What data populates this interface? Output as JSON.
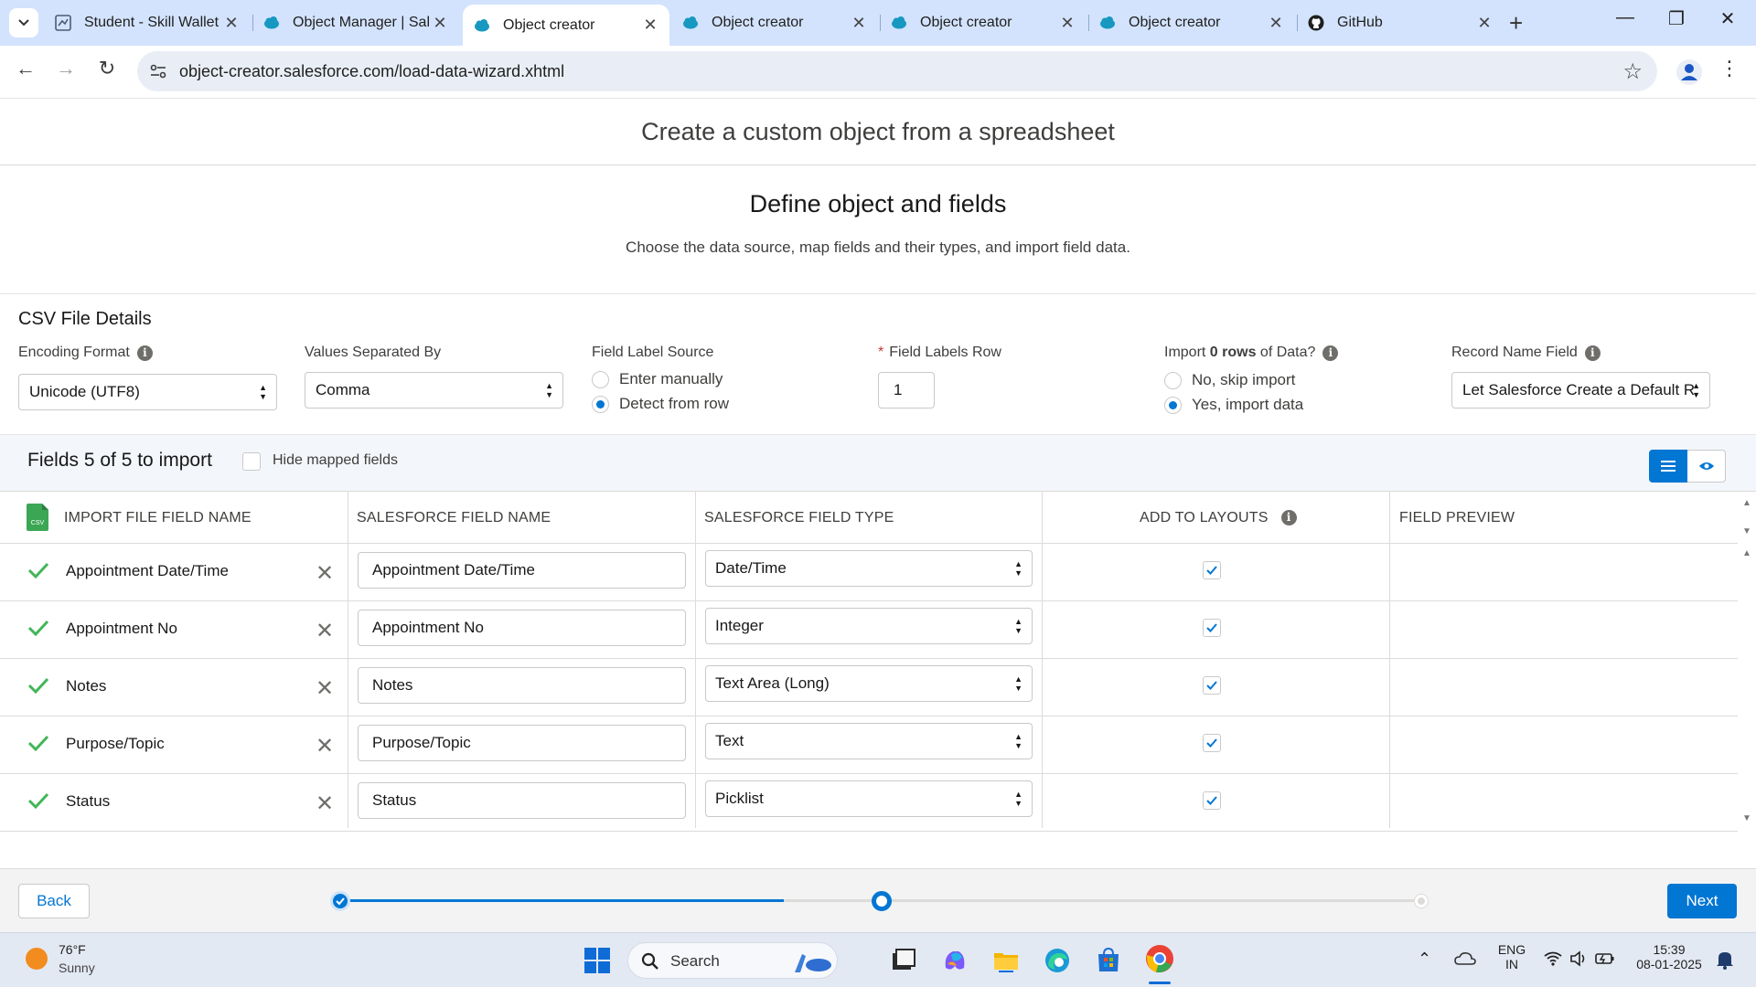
{
  "browser": {
    "tabs": [
      {
        "title": "Student - Skill Wallet",
        "favicon": "skill-wallet-icon",
        "active": false
      },
      {
        "title": "Object Manager | Sal",
        "favicon": "salesforce-cloud-icon",
        "active": false
      },
      {
        "title": "Object creator",
        "favicon": "salesforce-cloud-icon",
        "active": true
      },
      {
        "title": "Object creator",
        "favicon": "salesforce-cloud-icon",
        "active": false
      },
      {
        "title": "Object creator",
        "favicon": "salesforce-cloud-icon",
        "active": false
      },
      {
        "title": "Object creator",
        "favicon": "salesforce-cloud-icon",
        "active": false
      },
      {
        "title": "GitHub",
        "favicon": "github-icon",
        "active": false
      }
    ],
    "url": "object-creator.salesforce.com/load-data-wizard.xhtml"
  },
  "page": {
    "header": "Create a custom object from a spreadsheet",
    "step_title": "Define object and fields",
    "step_subtitle": "Choose the data source, map fields and their types, and import field data."
  },
  "csv": {
    "title": "CSV File Details",
    "encoding": {
      "label": "Encoding Format",
      "value": "Unicode (UTF8)"
    },
    "separator": {
      "label": "Values Separated By",
      "value": "Comma"
    },
    "label_source": {
      "label": "Field Label Source",
      "options": [
        "Enter manually",
        "Detect from row"
      ],
      "selected": "Detect from row"
    },
    "labels_row": {
      "required_mark": "*",
      "label": "Field Labels Row",
      "value": "1"
    },
    "import": {
      "label_pre": "Import ",
      "label_bold": "0 rows",
      "label_post": " of Data?",
      "options": [
        "No, skip import",
        "Yes, import data"
      ],
      "selected": "Yes, import data"
    },
    "record_name": {
      "label": "Record Name Field",
      "value": "Let Salesforce Create a Default R"
    }
  },
  "fields": {
    "title": "Fields 5 of 5 to import",
    "hide_mapped_label": "Hide mapped fields",
    "hide_mapped_checked": false,
    "columns": [
      "IMPORT FILE FIELD NAME",
      "SALESFORCE FIELD NAME",
      "SALESFORCE FIELD TYPE",
      "ADD TO LAYOUTS",
      "FIELD PREVIEW"
    ],
    "csv_icon_text": "CSV",
    "rows": [
      {
        "source": "Appointment Date/Time",
        "sf_name": "Appointment Date/Time",
        "type": "Date/Time",
        "add_to_layouts": true
      },
      {
        "source": "Appointment No",
        "sf_name": "Appointment No",
        "type": "Integer",
        "add_to_layouts": true
      },
      {
        "source": "Notes",
        "sf_name": "Notes",
        "type": "Text Area (Long)",
        "add_to_layouts": true
      },
      {
        "source": "Purpose/Topic",
        "sf_name": "Purpose/Topic",
        "type": "Text",
        "add_to_layouts": true
      },
      {
        "source": "Status",
        "sf_name": "Status",
        "type": "Picklist",
        "add_to_layouts": true
      }
    ]
  },
  "footer": {
    "back_label": "Back",
    "next_label": "Next",
    "progress_fraction": 0.41
  },
  "taskbar": {
    "weather_temp": "76°F",
    "weather_desc": "Sunny",
    "search_label": "Search",
    "lang_line1": "ENG",
    "lang_line2": "IN",
    "time": "15:39",
    "date": "08-01-2025"
  },
  "colors": {
    "accent": "#0176d3",
    "success": "#2e844a",
    "tabbar": "#d3e3fd"
  }
}
